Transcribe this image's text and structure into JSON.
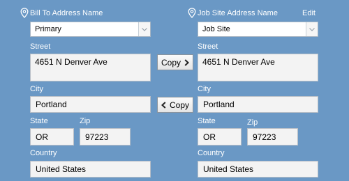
{
  "bill_to": {
    "address_name_label": "Bill To Address Name",
    "address_name_value": "Primary",
    "street_label": "Street",
    "street_value": "4651 N Denver Ave",
    "city_label": "City",
    "city_value": "Portland",
    "state_label": "State",
    "state_value": "OR",
    "zip_label": "Zip",
    "zip_value": "97223",
    "country_label": "Country",
    "country_value": "United States"
  },
  "job_site": {
    "address_name_label": "Job Site Address Name",
    "edit_label": "Edit",
    "address_name_value": "Job Site",
    "street_label": "Street",
    "street_value": "4651 N Denver Ave",
    "city_label": "City",
    "city_value": "Portland",
    "state_label": "State",
    "state_value": "OR",
    "zip_label": "Zip",
    "zip_value": "97223",
    "country_label": "Country",
    "country_value": "United States"
  },
  "actions": {
    "copy_right_label": "Copy",
    "copy_left_label": "Copy"
  },
  "icons": {
    "location": "location-pin-icon",
    "dropdown": "chevron-down-icon",
    "arrow_right": "chevron-right-icon",
    "arrow_left": "chevron-left-icon"
  }
}
